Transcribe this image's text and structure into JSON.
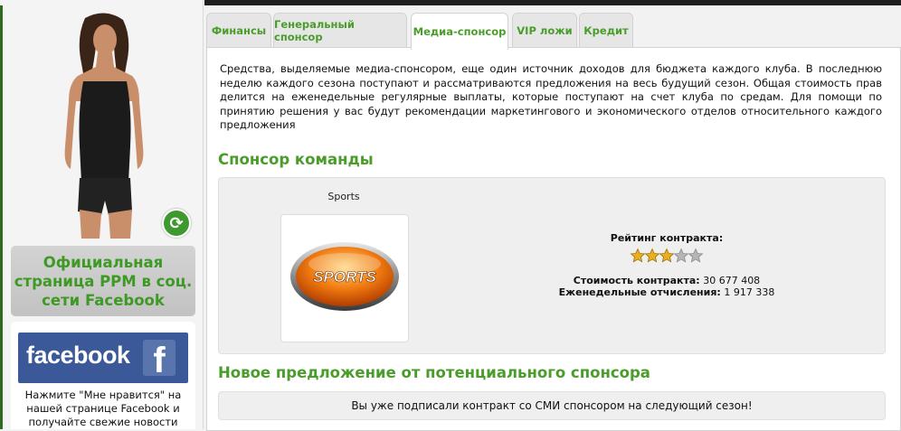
{
  "sidebar": {
    "facebook_official": "Официальная страница РРМ в соц. сети Facebook",
    "facebook_logo": "facebook",
    "facebook_text": "Нажмите \"Мне нравится\" на нашей странице Facebook и получайте свежие новости"
  },
  "tabs": [
    {
      "label": "Финансы"
    },
    {
      "label": "Генеральный спонсор"
    },
    {
      "label": "Медиа-спонсор",
      "active": true
    },
    {
      "label": "VIP ложи"
    },
    {
      "label": "Кредит"
    }
  ],
  "intro": "Средства, выделяемые медиа-спонсором, еще один источник доходов для бюджета каждого клуба. В последнюю неделю каждого сезона поступают и рассматриваются предложения на весь будущий сезон. Общая стоимость прав делится на еженедельные регулярные выплаты, которые поступают на счет клуба по средам. Для помощи по принятию решения у вас будут рекомендации маркетингового и экономического отделов относительного каждого предложения",
  "sponsor_section": {
    "title": "Спонсор команды",
    "sponsor_name": "Sports",
    "logo_text": "SPORTS",
    "rating_label": "Рейтинг контракта:",
    "rating": 3,
    "rating_max": 5,
    "cost_label": "Стоимость контракта:",
    "cost_value": "30 677 408",
    "weekly_label": "Еженедельные отчисления:",
    "weekly_value": "1 917 338"
  },
  "offer_section": {
    "title": "Новое предложение от потенциального спонсора",
    "notice": "Вы уже подписали контракт со СМИ спонсором на следующий сезон!"
  },
  "colors": {
    "accent_green": "#4a9d2a",
    "facebook_blue": "#3b5998",
    "star_gold": "#e8b020"
  }
}
